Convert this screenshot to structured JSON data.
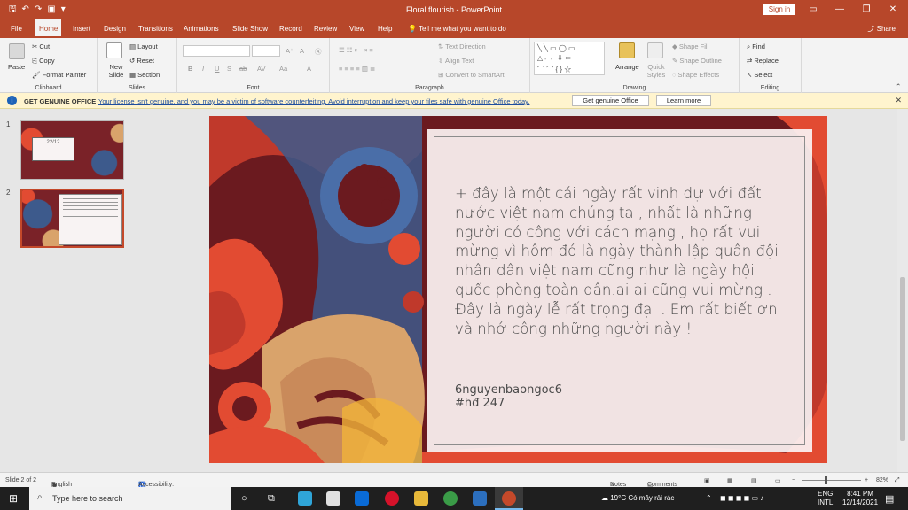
{
  "titlebar": {
    "title": "Floral flourish  -  PowerPoint",
    "signin": "Sign in"
  },
  "tabs": [
    "File",
    "Home",
    "Insert",
    "Design",
    "Transitions",
    "Animations",
    "Slide Show",
    "Record",
    "Review",
    "View",
    "Help"
  ],
  "tell_me": "Tell me what you want to do",
  "share": "Share",
  "ribbon": {
    "clipboard": {
      "paste": "Paste",
      "cut": "Cut",
      "copy": "Copy",
      "format_painter": "Format Painter",
      "label": "Clipboard"
    },
    "slides": {
      "new_slide": "New Slide",
      "layout": "Layout",
      "reset": "Reset",
      "section": "Section",
      "label": "Slides"
    },
    "font": {
      "label": "Font"
    },
    "paragraph": {
      "text_direction": "Text Direction",
      "align_text": "Align Text",
      "smartart": "Convert to SmartArt",
      "label": "Paragraph"
    },
    "drawing": {
      "arrange": "Arrange",
      "quick_styles": "Quick Styles",
      "shape_fill": "Shape Fill",
      "shape_outline": "Shape Outline",
      "shape_effects": "Shape Effects",
      "label": "Drawing"
    },
    "editing": {
      "find": "Find",
      "replace": "Replace",
      "select": "Select",
      "label": "Editing"
    }
  },
  "infobar": {
    "title": "GET GENUINE OFFICE",
    "message": "Your license isn't genuine, and you may be a victim of software counterfeiting. Avoid interruption and keep your files safe with genuine Office today.",
    "button1": "Get genuine Office",
    "button2": "Learn more"
  },
  "thumbnails": [
    {
      "number": "1",
      "date": "22/12"
    },
    {
      "number": "2"
    }
  ],
  "slide": {
    "body": "+ đây là một cái ngày rất vinh dự với đất nước việt nam chúng ta , nhất là những người có công với cách mạng , họ rất vui mừng vì hôm đó là ngày thành lập quân đội nhân dân việt nam cũng như là ngày hội quốc phòng toàn dân.ai ai cũng vui mừng . Đây là ngày lễ rất trọng đại . Em rất biết ơn và nhớ công những người này !",
    "author": "6nguyenbaongoc6",
    "tag": "#hđ 247"
  },
  "status": {
    "slide_count": "Slide 2 of 2",
    "language": "English (United States)",
    "accessibility": "Accessibility: Investigate",
    "notes": "Notes",
    "comments": "Comments",
    "zoom": "82%",
    "zoom_minus": "−",
    "zoom_plus": "+"
  },
  "taskbar": {
    "search_placeholder": "Type here to search",
    "weather": "19°C  Có mây rải rác",
    "lang1": "ENG",
    "lang2": "INTL",
    "time": "8:41 PM",
    "date": "12/14/2021"
  },
  "colors": {
    "accent": "#b7472a",
    "ribbon_bg": "#f3f3f3",
    "infobar_bg": "#fff4ce",
    "slide_bg": "#6b1a1f"
  }
}
